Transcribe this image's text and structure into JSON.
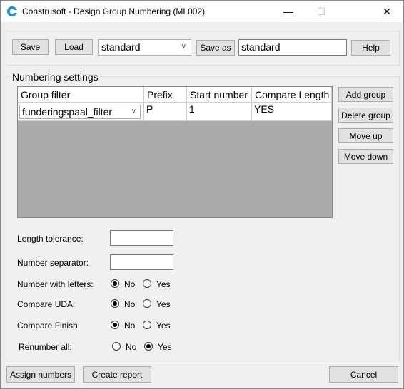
{
  "window": {
    "title": "Construsoft - Design Group Numbering (ML002)",
    "minimize": "—",
    "maximize": "☐",
    "close": "✕"
  },
  "toolbar": {
    "save_label": "Save",
    "load_label": "Load",
    "preset_value": "standard",
    "save_as_label": "Save as",
    "save_as_value": "standard",
    "help_label": "Help"
  },
  "numbering": {
    "group_title": "Numbering settings",
    "columns": [
      "Group filter",
      "Prefix",
      "Start number",
      "Compare Length"
    ],
    "rows": [
      {
        "group_filter": "funderingspaal_filter",
        "prefix": "P",
        "start_number": "1",
        "compare_length": "YES"
      }
    ],
    "add_group": "Add group",
    "delete_group": "Delete group",
    "move_up": "Move up",
    "move_down": "Move down"
  },
  "options": {
    "length_tolerance_label": "Length tolerance:",
    "length_tolerance_value": "",
    "number_separator_label": "Number separator:",
    "number_separator_value": "",
    "number_with_letters_label": "Number with letters:",
    "compare_uda_label": "Compare UDA:",
    "compare_finish_label": "Compare Finish:",
    "renumber_all_label": "Renumber all:",
    "no": "No",
    "yes": "Yes",
    "number_with_letters": "No",
    "compare_uda": "No",
    "compare_finish": "No",
    "renumber_all": "Yes"
  },
  "footer": {
    "assign_label": "Assign numbers",
    "report_label": "Create report",
    "cancel_label": "Cancel"
  }
}
